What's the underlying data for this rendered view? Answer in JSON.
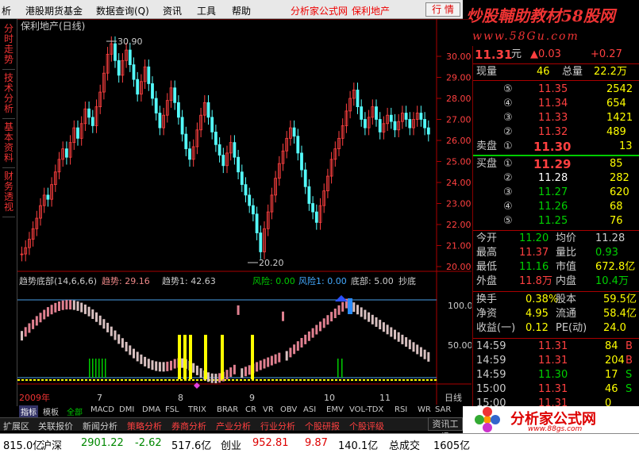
{
  "menu": {
    "items": [
      "析",
      "港股期货基金",
      "数据查询(Q)",
      "资讯",
      "工具",
      "帮助"
    ],
    "link1": "分析家公式网",
    "link2": "保利地产",
    "trade": "行 情",
    "close": "×"
  },
  "watermark": {
    "line1": "炒股輔助教材58股网",
    "line2": "www.58Gu.com"
  },
  "side_tabs": [
    "分时走势",
    "技术分析",
    "基本资料",
    "财务透视"
  ],
  "main_chart": {
    "title": "保利地产(日线)",
    "y_ticks": [
      "30.00",
      "29.00",
      "28.00",
      "27.00",
      "26.00",
      "25.00",
      "24.00",
      "23.00",
      "22.00",
      "21.00",
      "20.00"
    ],
    "high_marker": "30.90",
    "low_marker": "20.20"
  },
  "indicator": {
    "name": "趋势底部(14,6,6,6)",
    "trend_label": "趋势: 29.16",
    "trend1_label": "趋势1: 42.63",
    "risk_label": "风险: 0.00",
    "risk1_label": "风险1: 0.00",
    "bottom_label": "底部: 5.00",
    "buy_label": "抄底",
    "y_ticks": [
      "100.0",
      "50.00"
    ]
  },
  "x_axis": {
    "labels": [
      "2009年",
      "7",
      "8",
      "9",
      "10",
      "11"
    ],
    "period": "日线"
  },
  "quote": {
    "price": "11.31",
    "unit": "元",
    "change": "▲0.03",
    "change_pct": "+0.27",
    "now_vol_label": "现量",
    "now_vol": "46",
    "total_vol_label": "总量",
    "total_vol": "22.2万",
    "asks": [
      {
        "level": "⑤",
        "price": "11.35",
        "vol": "2542"
      },
      {
        "level": "④",
        "price": "11.34",
        "vol": "654"
      },
      {
        "level": "③",
        "price": "11.33",
        "vol": "1421"
      },
      {
        "level": "②",
        "price": "11.32",
        "vol": "489"
      },
      {
        "label": "卖盘",
        "level": "①",
        "price": "11.30",
        "vol": "13"
      }
    ],
    "bids": [
      {
        "label": "买盘",
        "level": "①",
        "price": "11.29",
        "vol": "85"
      },
      {
        "level": "②",
        "price": "11.28",
        "vol": "282"
      },
      {
        "level": "③",
        "price": "11.27",
        "vol": "620"
      },
      {
        "level": "④",
        "price": "11.26",
        "vol": "68"
      },
      {
        "level": "⑤",
        "price": "11.25",
        "vol": "76"
      }
    ],
    "stats": [
      {
        "l1": "今开",
        "v1": "11.20",
        "l2": "均价",
        "v2": "11.28"
      },
      {
        "l1": "最高",
        "v1": "11.37",
        "l2": "量比",
        "v2": "0.93"
      },
      {
        "l1": "最低",
        "v1": "11.16",
        "l2": "市值",
        "v2": "672.8亿"
      },
      {
        "l1": "外盘",
        "v1": "11.8万",
        "l2": "内盘",
        "v2": "10.4万"
      }
    ],
    "fund": [
      {
        "l1": "换手",
        "v1": "0.38%",
        "l2": "股本",
        "v2": "59.5亿"
      },
      {
        "l1": "净资",
        "v1": "4.95",
        "l2": "流通",
        "v2": "58.4亿"
      },
      {
        "l1": "收益(一)",
        "v1": "0.12",
        "l2": "PE(动)",
        "v2": "24.0"
      }
    ],
    "ticks": [
      {
        "time": "14:59",
        "price": "11.31",
        "vol": "84",
        "side": "B"
      },
      {
        "time": "14:59",
        "price": "11.31",
        "vol": "204",
        "side": "B"
      },
      {
        "time": "14:59",
        "price": "11.30",
        "vol": "17",
        "side": "S"
      },
      {
        "time": "15:00",
        "price": "11.31",
        "vol": "46",
        "side": "S"
      },
      {
        "time": "15:00",
        "price": "11.31",
        "vol": "0",
        "side": ""
      }
    ]
  },
  "bottom_tabs": [
    "指标",
    "模板",
    "全部",
    "MACD",
    "DMI",
    "DMA",
    "FSL",
    "TRIX",
    "BRAR",
    "CR",
    "VR",
    "OBV",
    "ASI",
    "EMV",
    "VOL-TDX",
    "RSI",
    "WR",
    "SAR"
  ],
  "info_tabs": [
    "扩展区",
    "关联报价",
    "新闻分析",
    "策略分析",
    "券商分析",
    "产业分析",
    "行业分析",
    "个股研报",
    "个股评级"
  ],
  "zxgc": "资讯工场",
  "ticker": [
    {
      "text": "815.0亿",
      "color": "#000"
    },
    {
      "text": "沪深",
      "color": "#000"
    },
    {
      "text": "2901.22",
      "color": "#080"
    },
    {
      "text": "-2.62",
      "color": "#080"
    },
    {
      "text": "517.6亿",
      "color": "#000"
    },
    {
      "text": "创业",
      "color": "#000"
    },
    {
      "text": "952.81",
      "color": "#d00"
    },
    {
      "text": "9.87",
      "color": "#d00"
    },
    {
      "text": "140.1亿",
      "color": "#000"
    },
    {
      "text": "总成交",
      "color": "#000"
    },
    {
      "text": "1605亿",
      "color": "#000"
    }
  ],
  "logo": {
    "text": "分析家公式网",
    "url": "www.88gs.com"
  },
  "colors": {
    "up": "#ff4040",
    "down": "#54fcfc",
    "bar_up": "#e08090",
    "bar_down": "#d8c0c0",
    "signal": "#ffff00",
    "bottom_bar": "#00cc00"
  }
}
